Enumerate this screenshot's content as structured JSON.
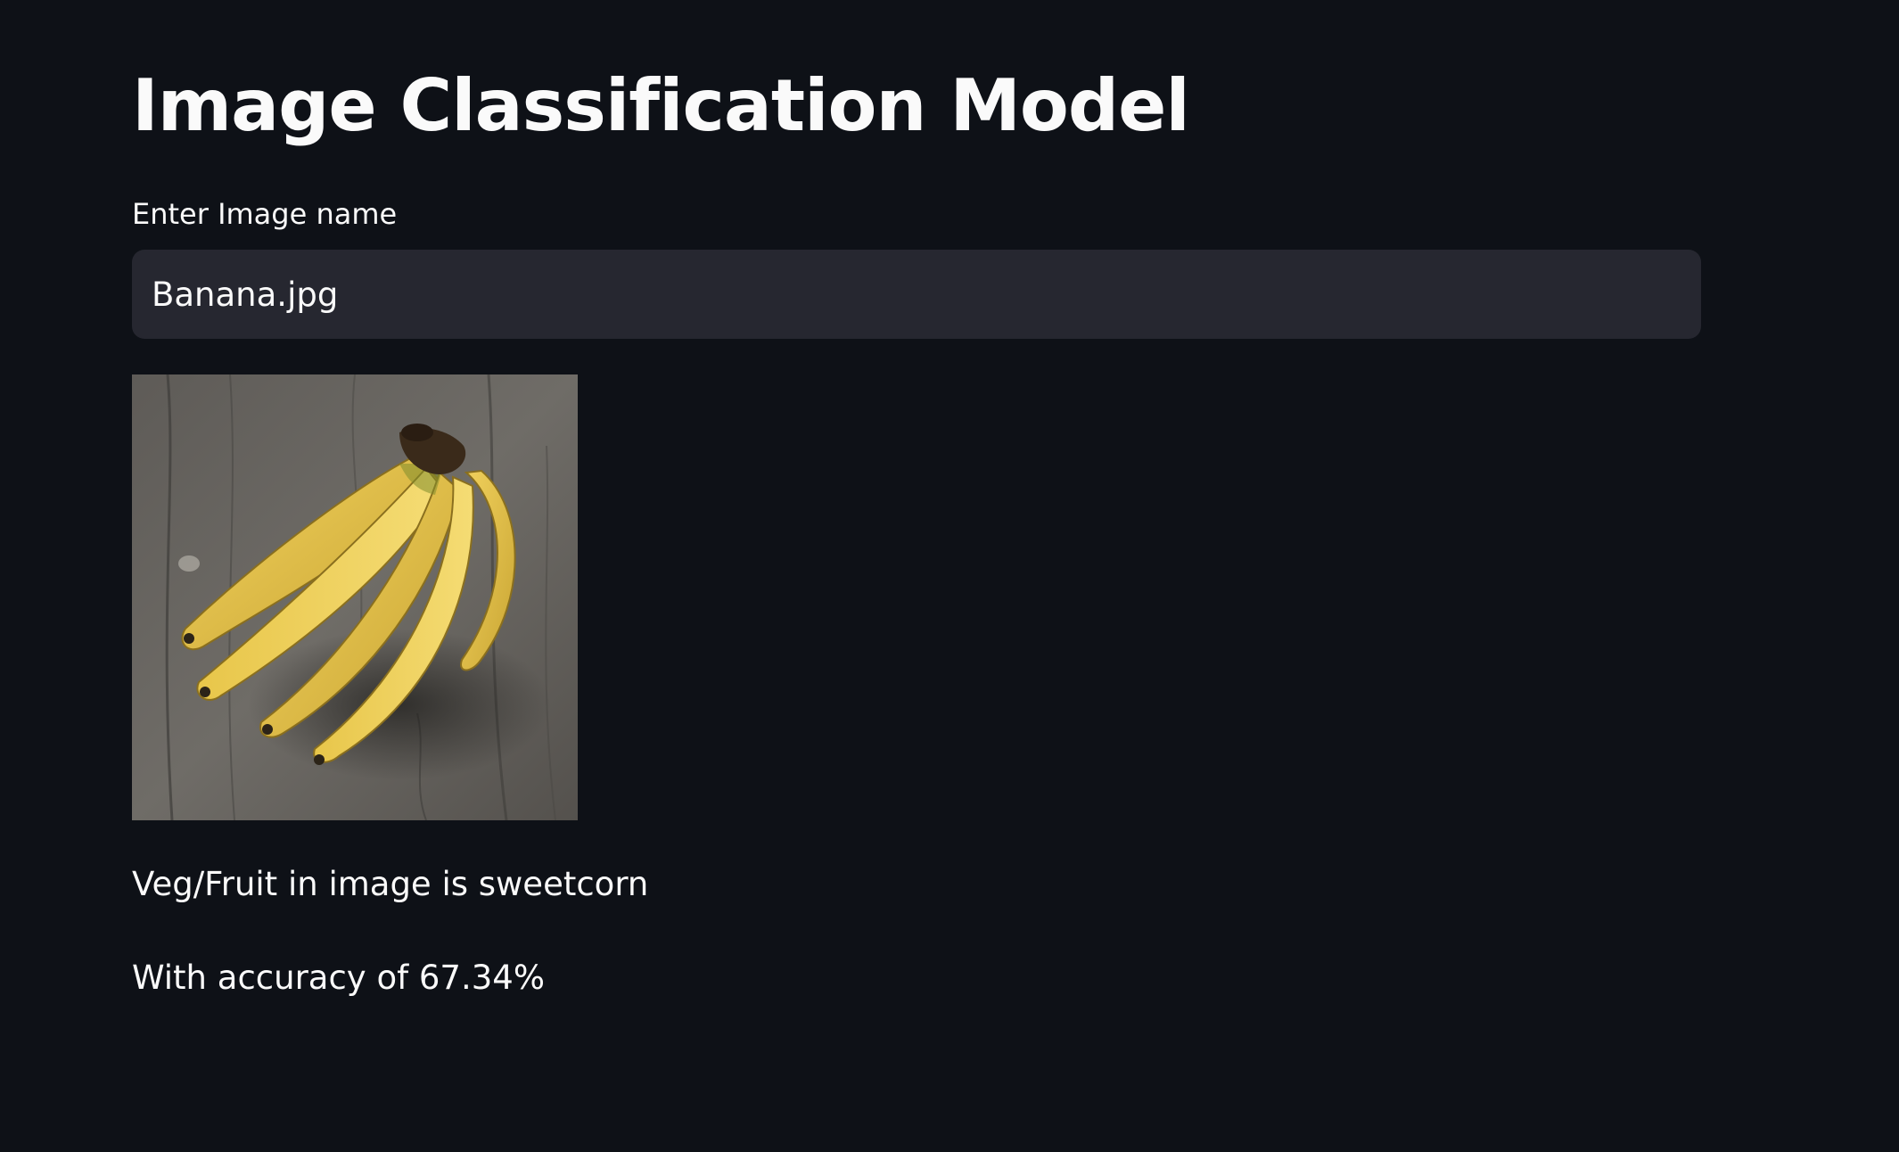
{
  "app": {
    "title": "Image Classification Model"
  },
  "input": {
    "label": "Enter Image name",
    "value": "Banana.jpg"
  },
  "image": {
    "subject": "banana-bunch"
  },
  "result": {
    "prediction_text": "Veg/Fruit in image is sweetcorn",
    "accuracy_text": "With accuracy of 67.34%"
  },
  "colors": {
    "background": "#0e1117",
    "input_background": "#262730",
    "text": "#fafafa"
  }
}
